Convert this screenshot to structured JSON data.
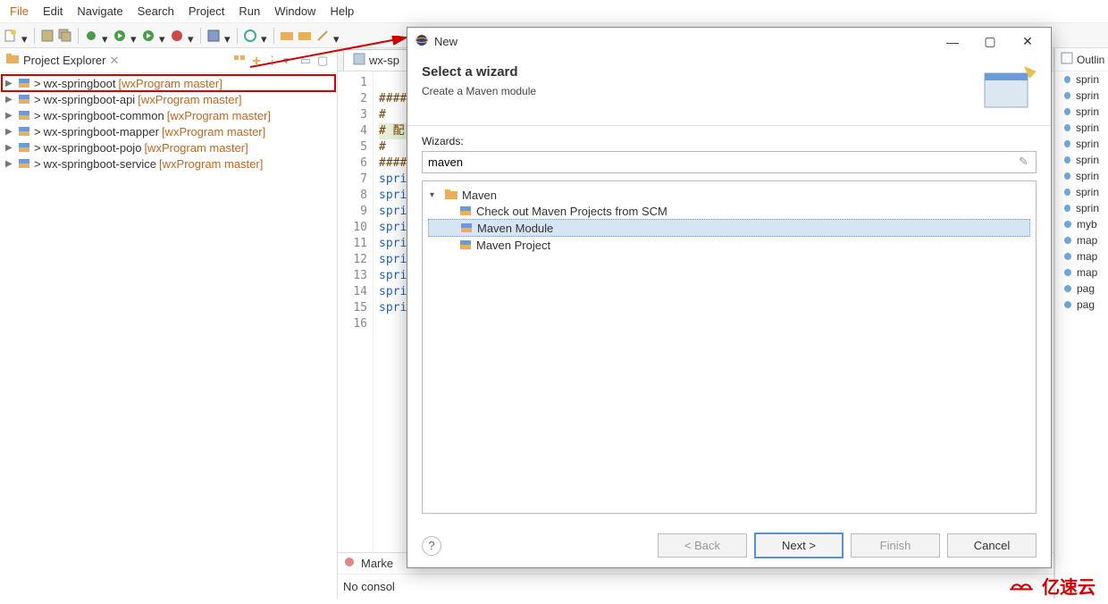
{
  "menubar": [
    "File",
    "Edit",
    "Navigate",
    "Search",
    "Project",
    "Run",
    "Window",
    "Help"
  ],
  "projectExplorer": {
    "title": "Project Explorer",
    "items": [
      {
        "name": "wx-springboot",
        "branch": "[wxProgram master]",
        "highlighted": true
      },
      {
        "name": "wx-springboot-api",
        "branch": "[wxProgram master]"
      },
      {
        "name": "wx-springboot-common",
        "branch": "[wxProgram master]"
      },
      {
        "name": "wx-springboot-mapper",
        "branch": "[wxProgram master]"
      },
      {
        "name": "wx-springboot-pojo",
        "branch": "[wxProgram master]"
      },
      {
        "name": "wx-springboot-service",
        "branch": "[wxProgram master]"
      }
    ]
  },
  "editor": {
    "tab": "wx-sp",
    "lines": [
      {
        "n": 1,
        "text": "",
        "cls": ""
      },
      {
        "n": 2,
        "text": "####",
        "cls": "hash"
      },
      {
        "n": 3,
        "text": "#",
        "cls": "hash"
      },
      {
        "n": 4,
        "text": "# 配",
        "cls": "hash cfg"
      },
      {
        "n": 5,
        "text": "#",
        "cls": "hash"
      },
      {
        "n": 6,
        "text": "####",
        "cls": "hash"
      },
      {
        "n": 7,
        "text": "spri",
        "cls": "key"
      },
      {
        "n": 8,
        "text": "spri",
        "cls": "key"
      },
      {
        "n": 9,
        "text": "spri",
        "cls": "key"
      },
      {
        "n": 10,
        "text": "spri",
        "cls": "key"
      },
      {
        "n": 11,
        "text": "spri",
        "cls": "key"
      },
      {
        "n": 12,
        "text": "spri",
        "cls": "key"
      },
      {
        "n": 13,
        "text": "spri",
        "cls": "key"
      },
      {
        "n": 14,
        "text": "spri",
        "cls": "key"
      },
      {
        "n": 15,
        "text": "spri",
        "cls": "key"
      },
      {
        "n": 16,
        "text": "",
        "cls": ""
      }
    ]
  },
  "outline": {
    "title": "Outlin",
    "items": [
      "sprin",
      "sprin",
      "sprin",
      "sprin",
      "sprin",
      "sprin",
      "sprin",
      "sprin",
      "sprin",
      "myb",
      "map",
      "map",
      "map",
      "pag",
      "pag"
    ]
  },
  "bottom": {
    "tab1": "Marke",
    "console": "No consol"
  },
  "dialog": {
    "title": "New",
    "bannerTitle": "Select a wizard",
    "bannerDesc": "Create a Maven module",
    "wizardsLabel": "Wizards:",
    "filter": "maven",
    "tree": {
      "folder": "Maven",
      "items": [
        "Check out Maven Projects from SCM",
        "Maven Module",
        "Maven Project"
      ],
      "selectedIndex": 1
    },
    "buttons": {
      "back": "< Back",
      "next": "Next >",
      "finish": "Finish",
      "cancel": "Cancel"
    }
  },
  "brand": "亿速云"
}
